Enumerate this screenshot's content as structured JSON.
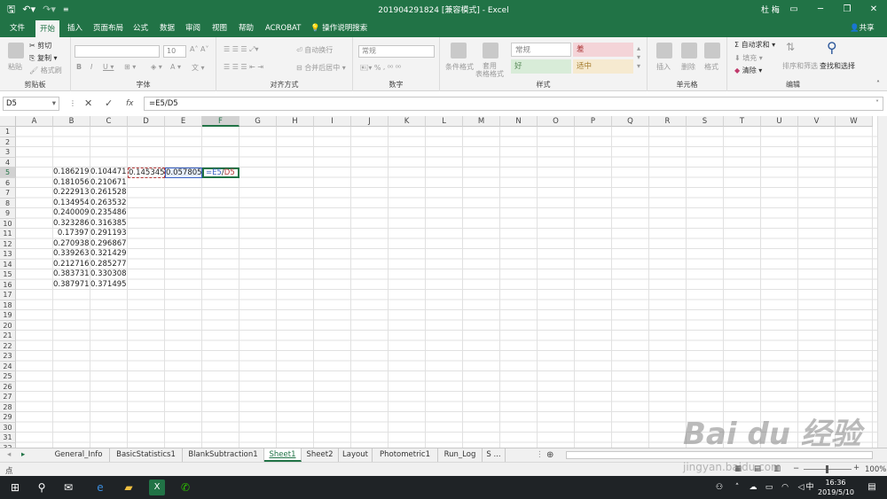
{
  "window": {
    "title": "201904291824 [兼容模式] - Excel",
    "user": "杜 梅",
    "qat_icons": [
      "save-icon",
      "undo-icon",
      "redo-icon",
      "customize-icon"
    ],
    "controls": [
      "restore-ribbon-icon",
      "minimize-icon",
      "maximize-icon",
      "close-icon"
    ]
  },
  "ribbon_tabs": [
    {
      "label": "文件"
    },
    {
      "label": "开始",
      "active": true
    },
    {
      "label": "插入"
    },
    {
      "label": "页面布局"
    },
    {
      "label": "公式"
    },
    {
      "label": "数据"
    },
    {
      "label": "审阅"
    },
    {
      "label": "视图"
    },
    {
      "label": "帮助"
    },
    {
      "label": "ACROBAT"
    }
  ],
  "tell_me": "操作说明搜索",
  "share": "共享",
  "ribbon": {
    "clipboard": {
      "label": "剪贴板",
      "paste": "粘贴",
      "cut": "剪切",
      "copy": "复制",
      "format_painter": "格式刷"
    },
    "font": {
      "label": "字体",
      "font_name": "",
      "font_size": "10"
    },
    "alignment": {
      "label": "对齐方式",
      "wrap": "自动换行",
      "merge": "合并后居中"
    },
    "number": {
      "label": "数字",
      "format": "常规"
    },
    "styles": {
      "label": "样式",
      "conditional": "条件格式",
      "table": "套用\n表格格式",
      "cells": [
        "常规",
        "差",
        "好",
        "适中"
      ]
    },
    "cells": {
      "label": "单元格",
      "insert": "插入",
      "delete": "删除",
      "format": "格式"
    },
    "editing": {
      "label": "编辑",
      "autosum": "自动求和",
      "fill": "填充",
      "clear": "清除",
      "sort": "排序和筛选",
      "find": "查找和选择"
    }
  },
  "formula_bar": {
    "name_box": "D5",
    "formula": "=E5/D5",
    "fx": "fx"
  },
  "columns": [
    "A",
    "B",
    "C",
    "D",
    "E",
    "F",
    "G",
    "H",
    "I",
    "J",
    "K",
    "L",
    "M",
    "N",
    "O",
    "P",
    "Q",
    "R",
    "S",
    "T",
    "U",
    "V",
    "W"
  ],
  "rows": [
    "1",
    "2",
    "3",
    "4",
    "5",
    "6",
    "7",
    "8",
    "9",
    "10",
    "11",
    "12",
    "13",
    "14",
    "15",
    "16",
    "17",
    "18",
    "19",
    "20",
    "21",
    "22",
    "23",
    "24",
    "25",
    "26",
    "27",
    "28",
    "29",
    "30",
    "31",
    "32"
  ],
  "cells": {
    "B": [
      "0.186219",
      "0.181056",
      "0.222913",
      "0.134954",
      "0.240009",
      "0.323286",
      "0.17397",
      "0.270938",
      "0.339263",
      "0.212716",
      "0.383731",
      "0.387971"
    ],
    "C": [
      "0.104471",
      "0.210671",
      "0.261528",
      "0.263532",
      "0.235486",
      "0.316385",
      "0.291193",
      "0.296867",
      "0.321429",
      "0.285277",
      "0.330308",
      "0.371495"
    ],
    "D5": "0.145345",
    "E5": "0.057805",
    "F5_editing": {
      "text1": "=E5",
      "sep": "/",
      "text2": "D5"
    }
  },
  "sheet_tabs": [
    "General_Info",
    "BasicStatistics1",
    "BlankSubtraction1",
    "Sheet1",
    "Sheet2",
    "Layout",
    "Photometric1",
    "Run_Log",
    "S ..."
  ],
  "active_sheet": "Sheet1",
  "status": {
    "mode": "点",
    "zoom": "100%"
  },
  "taskbar": {
    "time": "16:36",
    "date": "2019/5/10",
    "ime": "中"
  },
  "watermark": {
    "main": "Bai du 经验",
    "sub": "jingyan.baidu.com"
  },
  "colors": {
    "excel_green": "#217346",
    "ref_blue": "#3b62c4",
    "copy_red": "#b83b3b"
  }
}
